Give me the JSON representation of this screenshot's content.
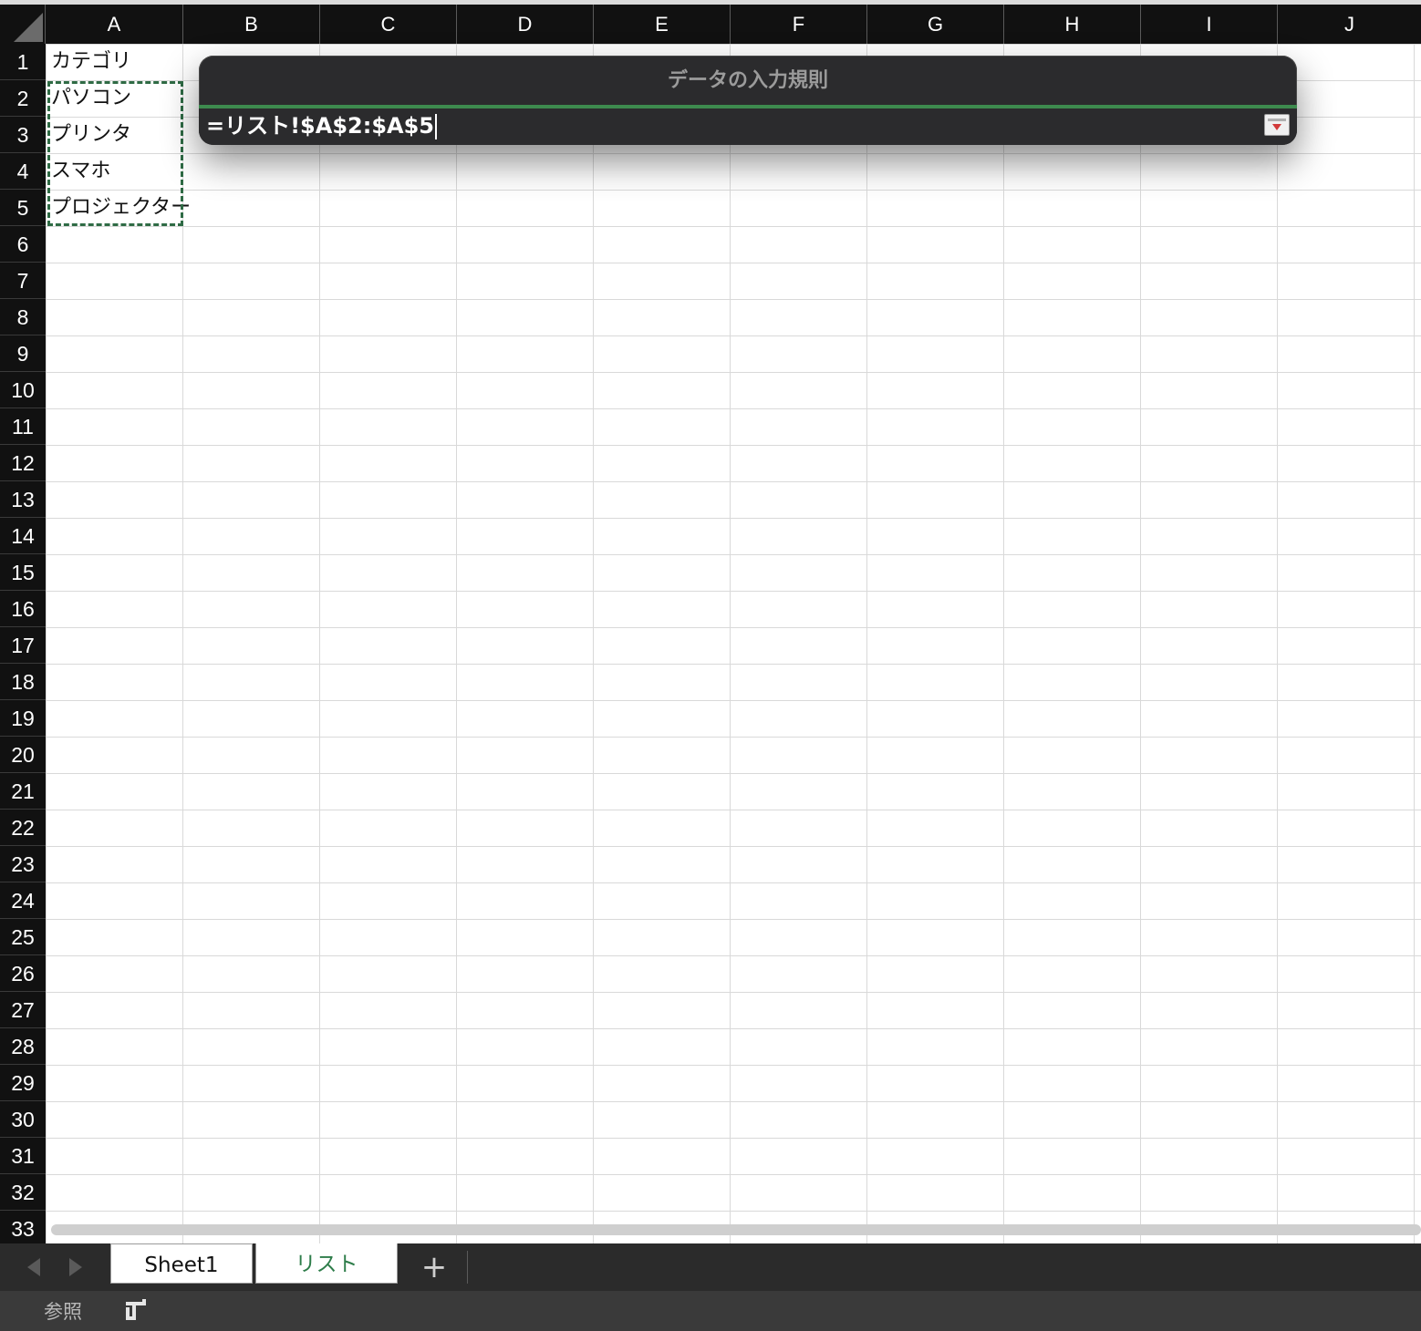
{
  "columns": [
    "A",
    "B",
    "C",
    "D",
    "E",
    "F",
    "G",
    "H",
    "I",
    "J"
  ],
  "rows": [
    "1",
    "2",
    "3",
    "4",
    "5",
    "6",
    "7",
    "8",
    "9",
    "10",
    "11",
    "12",
    "13",
    "14",
    "15",
    "16",
    "17",
    "18",
    "19",
    "20",
    "21",
    "22",
    "23",
    "24",
    "25",
    "26",
    "27",
    "28",
    "29",
    "30",
    "31",
    "32",
    "33"
  ],
  "cells": {
    "A1": "カテゴリ",
    "A2": "パソコン",
    "A3": "プリンタ",
    "A4": "スマホ",
    "A5": "プロジェクター"
  },
  "dialog": {
    "title": "データの入力規則",
    "reference_value": "=リスト!$A$2:$A$5"
  },
  "sheet_tabs": {
    "tab1": "Sheet1",
    "tab2": "リスト",
    "add_label": "+"
  },
  "status_bar": {
    "mode": "参照"
  },
  "colors": {
    "header_bg": "#111111",
    "active_tab_text": "#2e7d4a",
    "selection_border": "#2f6b45",
    "dialog_bg": "#2b2b2d"
  }
}
